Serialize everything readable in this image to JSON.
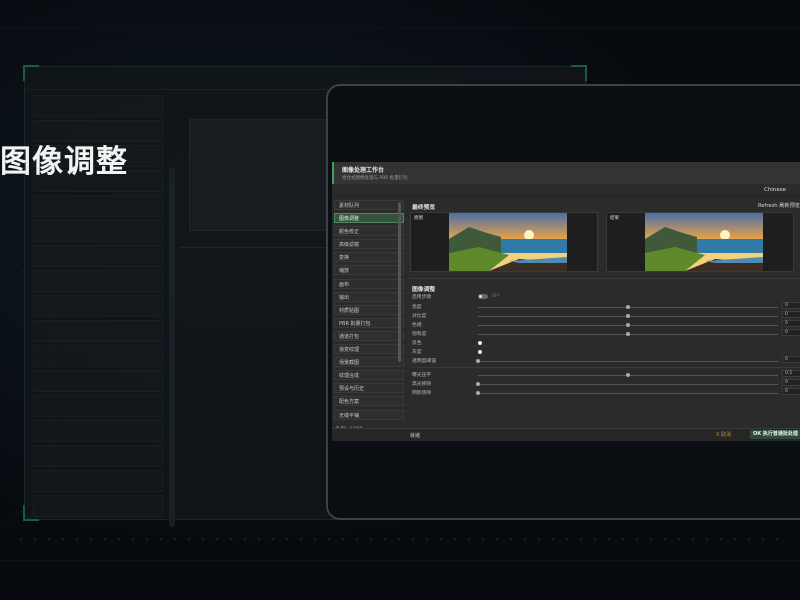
{
  "headline": "图像调整",
  "app": {
    "title": "图像处理工作台",
    "subtitle": "组合式图像处理与 PBR 批量打包",
    "language": "Chinese",
    "sidebar": {
      "items": [
        {
          "label": "素材队列",
          "active": false
        },
        {
          "label": "图像调整",
          "active": true
        },
        {
          "label": "颜色校正",
          "active": false
        },
        {
          "label": "高级滤镜",
          "active": false
        },
        {
          "label": "变换",
          "active": false
        },
        {
          "label": "缩放",
          "active": false
        },
        {
          "label": "画布",
          "active": false
        },
        {
          "label": "输出",
          "active": false
        },
        {
          "label": "材质贴图",
          "active": false
        },
        {
          "label": "PBR 批量打包",
          "active": false
        },
        {
          "label": "通道打包",
          "active": false
        },
        {
          "label": "渐变纹理",
          "active": false
        },
        {
          "label": "场景截图",
          "active": false
        },
        {
          "label": "纹理合成",
          "active": false
        },
        {
          "label": "预设与历史",
          "active": false
        },
        {
          "label": "配色方案",
          "active": false
        },
        {
          "label": "无缝平铺",
          "active": false
        }
      ],
      "count_label": "队列：1/300"
    },
    "preview": {
      "title": "最终预览",
      "refresh_label": "Refresh 刷新预览",
      "original_label": "原图",
      "result_label": "结果"
    },
    "adjust": {
      "title": "图像调整",
      "enable_label": "启用步骤",
      "enable_state": "OFF",
      "rows": [
        {
          "label": "亮度",
          "value": "0",
          "pos": 0.5
        },
        {
          "label": "对比度",
          "value": "0",
          "pos": 0.5
        },
        {
          "label": "色相",
          "value": "0",
          "pos": 0.5
        },
        {
          "label": "饱和度",
          "value": "0",
          "pos": 0.5
        }
      ],
      "invert_label": "反色",
      "grayscale_label": "灰度",
      "threshold": {
        "label": "透明度阈值",
        "value": "0",
        "pos": 0.0
      },
      "rows2": [
        {
          "label": "曝光压平",
          "value": "0.5",
          "pos": 0.5
        },
        {
          "label": "高光移除",
          "value": "0",
          "pos": 0.0
        },
        {
          "label": "阴影移除",
          "value": "0",
          "pos": 0.0
        }
      ]
    },
    "status": "就绪",
    "cancel_label": "X 取消",
    "ok_label": "OK 执行普通批处理"
  },
  "colors": {
    "accent": "#3da35a",
    "panel": "#2b2b2b",
    "background": "#070b10"
  }
}
